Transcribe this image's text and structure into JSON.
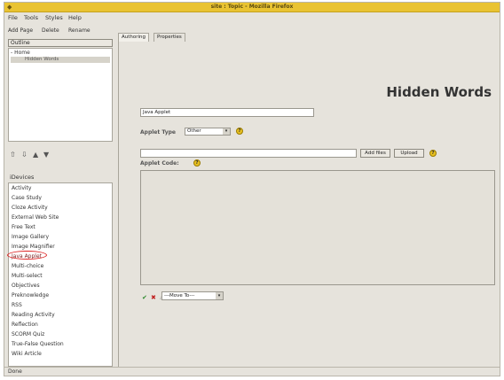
{
  "window": {
    "title": "site : Topic - Mozilla Firefox"
  },
  "menu": {
    "items": [
      "File",
      "Tools",
      "Styles",
      "Help"
    ]
  },
  "left_toolbar": {
    "add_page": "Add Page",
    "delete": "Delete",
    "rename": "Rename"
  },
  "outline": {
    "tab_label": "Outline",
    "home": "- Home",
    "child": "Hidden Words"
  },
  "devices": {
    "tab_label": "iDevices",
    "items": [
      "Activity",
      "Case Study",
      "Cloze Activity",
      "External Web Site",
      "Free Text",
      "Image Gallery",
      "Image Magnifier",
      "Java Applet",
      "Multi-choice",
      "Multi-select",
      "Objectives",
      "Preknowledge",
      "RSS",
      "Reading Activity",
      "Reflection",
      "SCORM Quiz",
      "True-False Question",
      "Wiki Article"
    ],
    "selected": "Java Applet"
  },
  "main": {
    "tabs": [
      "Authoring",
      "Properties"
    ],
    "heading": "Hidden Words",
    "name_value": "Java Applet",
    "applet_type_label": "Applet Type",
    "applet_type_value": "Other",
    "add_files_label": "Add files",
    "upload_label": "Upload",
    "applet_code_label": "Applet Code:",
    "move_to_value": "---Move To---"
  },
  "status": {
    "text": "Done"
  },
  "colors": {
    "titlebar": "#e9c332",
    "help_icon": "#e8c020",
    "selection_circle": "#dd2222"
  }
}
